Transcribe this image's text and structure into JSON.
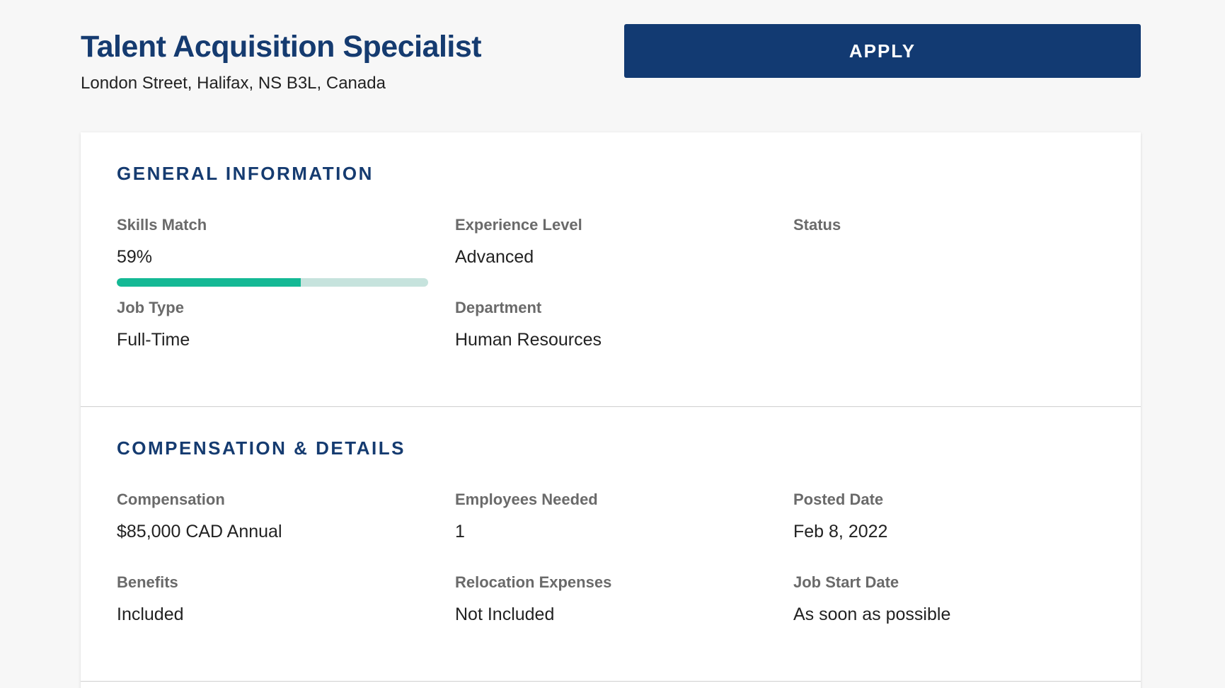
{
  "job": {
    "title": "Talent Acquisition Specialist",
    "location": "London Street, Halifax, NS B3L, Canada",
    "apply_label": "APPLY"
  },
  "general": {
    "title": "GENERAL INFORMATION",
    "skills_match": {
      "label": "Skills Match",
      "value": "59%",
      "progress": 0.59
    },
    "experience_level": {
      "label": "Experience Level",
      "value": "Advanced"
    },
    "status": {
      "label": "Status",
      "value": ""
    },
    "job_type": {
      "label": "Job Type",
      "value": "Full-Time"
    },
    "department": {
      "label": "Department",
      "value": "Human Resources"
    }
  },
  "compensation": {
    "title": "COMPENSATION & DETAILS",
    "compensation": {
      "label": "Compensation",
      "value": "$85,000 CAD Annual"
    },
    "employees_needed": {
      "label": "Employees Needed",
      "value": "1"
    },
    "posted_date": {
      "label": "Posted Date",
      "value": "Feb 8, 2022"
    },
    "benefits": {
      "label": "Benefits",
      "value": "Included"
    },
    "relocation": {
      "label": "Relocation Expenses",
      "value": "Not Included"
    },
    "start_date": {
      "label": "Job Start Date",
      "value": "As soon as possible"
    }
  },
  "colors": {
    "brand": "#123a72",
    "title": "#153b70",
    "progress_fill": "#14b995",
    "progress_track": "#c6e3dd"
  }
}
